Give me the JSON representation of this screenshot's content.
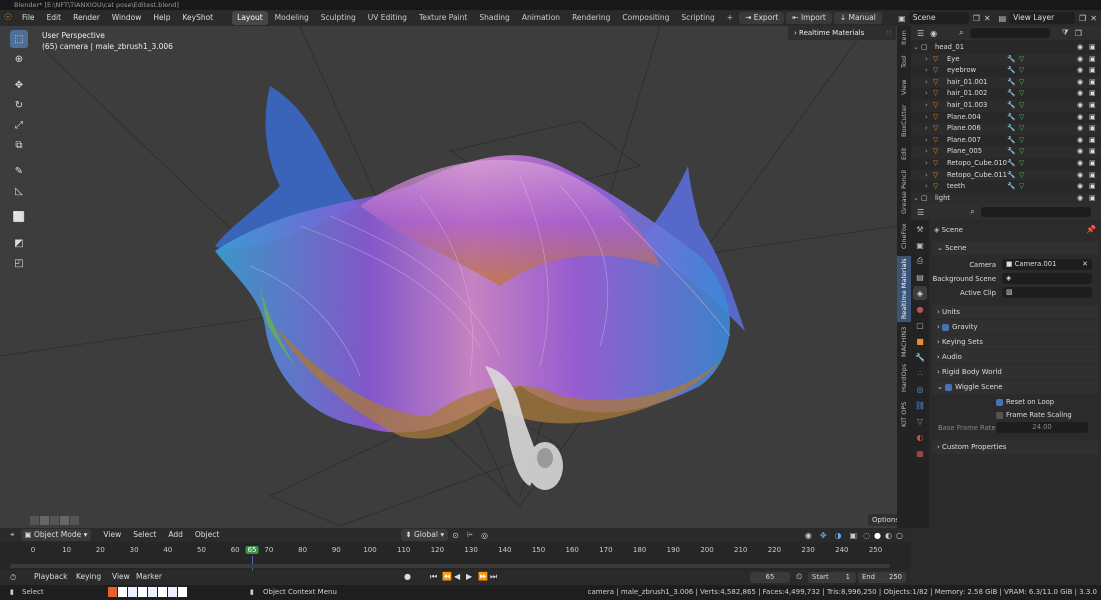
{
  "window_title": "Blender* [E:\\NFT\\TIANXIOU\\cat pose\\Editest.blend]",
  "menus": [
    "File",
    "Edit",
    "Render",
    "Window",
    "Help",
    "KeyShot"
  ],
  "workspaces": [
    "Layout",
    "Modeling",
    "Sculpting",
    "UV Editing",
    "Texture Paint",
    "Shading",
    "Animation",
    "Rendering",
    "Compositing",
    "Scripting"
  ],
  "active_workspace": "Layout",
  "add_workspace": "+",
  "header_buttons": {
    "export": "Export",
    "import": "Import",
    "manual": "Manual"
  },
  "scene_field": "Scene",
  "view_layer_field": "View Layer",
  "viewport": {
    "perspective": "User Perspective",
    "object_info": "(65) camera | male_zbrush1_3.006",
    "realtime_panel": "Realtime Materials",
    "options": "Options"
  },
  "viewport_header": {
    "mode": "Object Mode",
    "menus": [
      "View",
      "Select",
      "Add",
      "Object"
    ],
    "transform": "Global"
  },
  "n_tabs": [
    "Item",
    "Tool",
    "View",
    "BoxCutter",
    "Edit",
    "Grease Pencil",
    "CineFox",
    "Realtime Materials",
    "MACHIN3",
    "HardOps",
    "KIT OPS"
  ],
  "n_tab_active": "Realtime Materials",
  "outliner": [
    {
      "name": "head_01",
      "level": 0
    },
    {
      "name": "Eye",
      "level": 1
    },
    {
      "name": "eyebrow",
      "level": 1
    },
    {
      "name": "hair_01.001",
      "level": 1
    },
    {
      "name": "hair_01.002",
      "level": 1
    },
    {
      "name": "hair_01.003",
      "level": 1
    },
    {
      "name": "Plane.004",
      "level": 1
    },
    {
      "name": "Plane.006",
      "level": 1
    },
    {
      "name": "Plane.007",
      "level": 1
    },
    {
      "name": "Plane_005",
      "level": 1
    },
    {
      "name": "Retopo_Cube.010",
      "level": 1
    },
    {
      "name": "Retopo_Cube.011",
      "level": 1
    },
    {
      "name": "teeth",
      "level": 1
    },
    {
      "name": "light",
      "level": 0
    }
  ],
  "properties": {
    "breadcrumb": "Scene",
    "scene_panel": "Scene",
    "camera_label": "Camera",
    "camera_value": "Camera.001",
    "background_scene_label": "Background Scene",
    "active_clip_label": "Active Clip",
    "units": "Units",
    "gravity": "Gravity",
    "keying_sets": "Keying Sets",
    "audio": "Audio",
    "rigid_body_world": "Rigid Body World",
    "wiggle_scene": "Wiggle Scene",
    "reset_on_loop": "Reset on Loop",
    "frame_rate_scaling": "Frame Rate Scaling",
    "base_frame_rate_label": "Base Frame Rate",
    "base_frame_rate_value": "24.00",
    "custom_properties": "Custom Properties"
  },
  "timeline": {
    "ticks": [
      "0",
      "10",
      "20",
      "30",
      "40",
      "50",
      "60",
      "65",
      "70",
      "80",
      "90",
      "100",
      "110",
      "120",
      "130",
      "140",
      "150",
      "160",
      "170",
      "180",
      "190",
      "200",
      "210",
      "220",
      "230",
      "240",
      "250"
    ],
    "current_frame": "65",
    "start_label": "Start",
    "start_value": "1",
    "end_label": "End",
    "end_value": "250",
    "menus": [
      "Playback",
      "Keying",
      "View",
      "Marker"
    ]
  },
  "status_bar": {
    "left": "Select",
    "middle": "Object Context Menu",
    "right": "camera | male_zbrush1_3.006 | Verts:4,582,865 | Faces:4,499,732 | Tris:8,996,250 | Objects:1/82 | Memory: 2.58 GiB | VRAM: 6.3/11.0 GiB | 3.3.0"
  },
  "colors": {
    "accent": "#4772b3",
    "frame_marker": "#3d8f47",
    "header": "#2a2a2a",
    "viewport": "#3d3d3d"
  }
}
